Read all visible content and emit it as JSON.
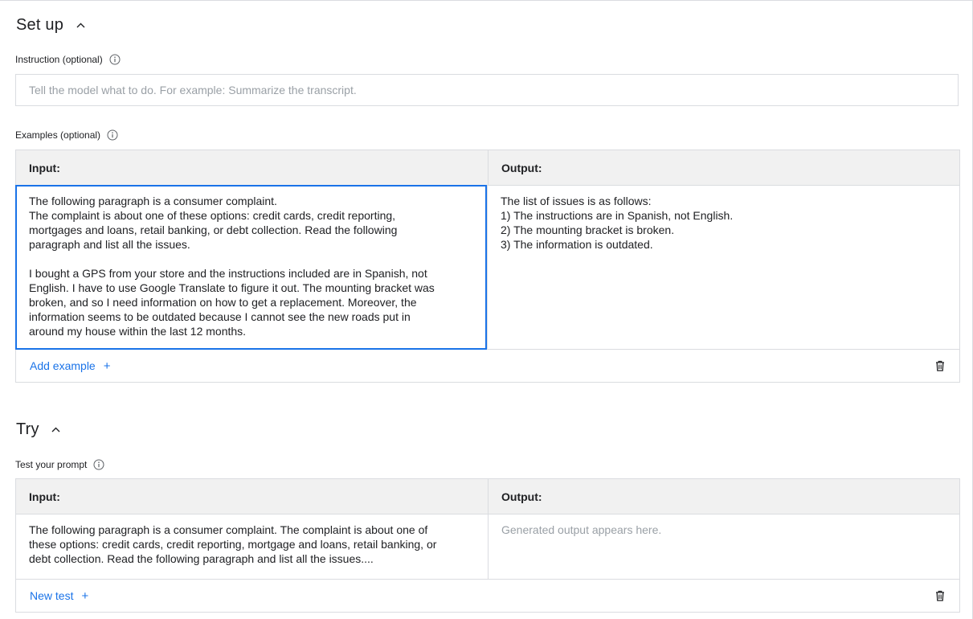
{
  "setup": {
    "title": "Set up",
    "instruction_label": "Instruction (optional)",
    "instruction_placeholder": "Tell the model what to do. For example: Summarize the transcript.",
    "examples_label": "Examples (optional)",
    "examples_table": {
      "input_header": "Input:",
      "output_header": "Output:",
      "rows": [
        {
          "input": "The following paragraph is a consumer complaint.\nThe complaint is about one of these options: credit cards, credit reporting,\nmortgages and loans, retail banking, or debt collection. Read the following\nparagraph and list all the issues.\n\nI bought a GPS from your store and the instructions included are in Spanish, not\nEnglish. I have to use Google Translate to figure it out. The mounting bracket was\nbroken, and so I need information on how to get a replacement. Moreover, the\ninformation seems to be outdated because I cannot see the new roads put in\naround my house within the last 12 months.",
          "output": "The list of issues is as follows:\n1) The instructions are in Spanish, not English.\n2) The mounting bracket is broken.\n3) The information is outdated."
        }
      ],
      "add_label": "Add example",
      "add_icon": "+"
    }
  },
  "try": {
    "title": "Try",
    "test_label": "Test your prompt",
    "test_table": {
      "input_header": "Input:",
      "output_header": "Output:",
      "input": "The following paragraph is a consumer complaint. The complaint is about one of\nthese options: credit cards, credit reporting, mortgage and loans, retail banking, or\ndebt collection. Read the following paragraph and list all the issues....",
      "output_placeholder": "Generated output appears here.",
      "add_label": "New test",
      "add_icon": "+"
    }
  },
  "icons": {
    "chevron": "chevron-up-icon",
    "info": "info-icon",
    "delete": "trash-icon"
  },
  "colors": {
    "accent": "#1a73e8",
    "border": "#dadce0",
    "header_bg": "#f1f1f1",
    "placeholder": "#9aa0a6"
  }
}
